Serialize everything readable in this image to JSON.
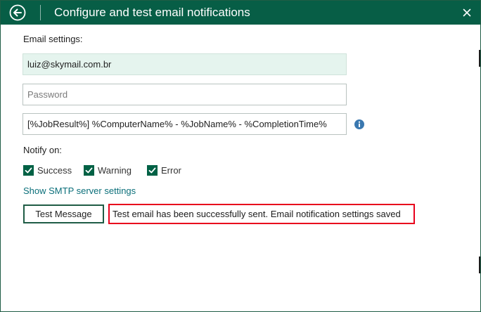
{
  "window": {
    "title": "Configure and test email notifications",
    "icons": {
      "back": "back-arrow-circle-icon",
      "close": "close-icon"
    }
  },
  "email_settings": {
    "label": "Email settings:",
    "email_value": "luiz@skymail.com.br",
    "password_placeholder": "Password",
    "subject_value": "[%JobResult%] %ComputerName% - %JobName% - %CompletionTime%",
    "info_icon": "info-icon"
  },
  "notify": {
    "label": "Notify on:",
    "options": [
      {
        "label": "Success",
        "checked": true
      },
      {
        "label": "Warning",
        "checked": true
      },
      {
        "label": "Error",
        "checked": true
      }
    ]
  },
  "smtp_link": "Show SMTP server settings",
  "test": {
    "button_label": "Test Message",
    "status_message": "Test email has been successfully sent. Email notification settings saved"
  },
  "colors": {
    "title_bar": "#075e46",
    "accent": "#006145",
    "link": "#0b6f7a",
    "highlight_border": "#e8001c",
    "filled_field": "#e5f4ee"
  }
}
